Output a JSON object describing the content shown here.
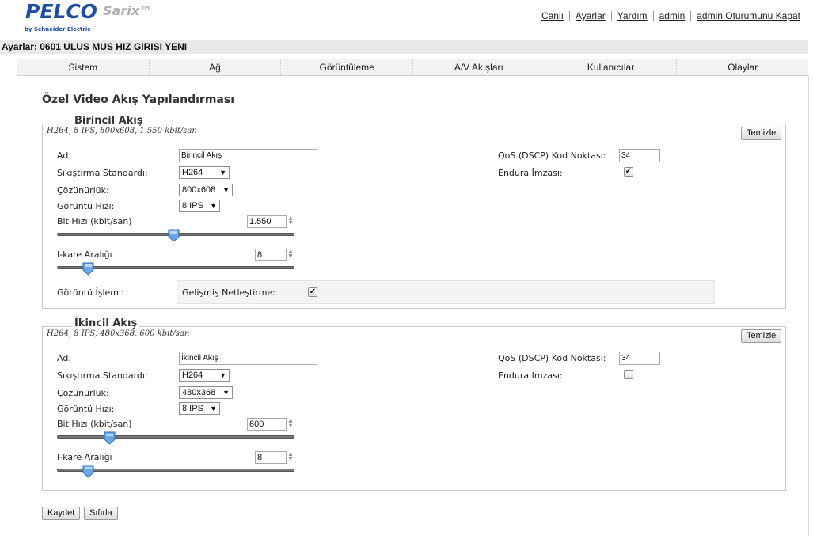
{
  "brand": {
    "logo": "PELCO",
    "product": "Sarix™",
    "sublogo": "by Schneider Electric"
  },
  "topnav": [
    "Canlı",
    "Ayarlar",
    "Yardım",
    "admin",
    "admin Oturumunu Kapat"
  ],
  "title_bar": "Ayarlar: 0601 ULUS MUS HIZ GIRISI YENI",
  "tabs": [
    "Sistem",
    "Ağ",
    "Görüntüleme",
    "A/V Akışları",
    "Kullanıcılar",
    "Olaylar"
  ],
  "page_title": "Özel Video Akış Yapılandırması",
  "primary": {
    "legend": "Birincil Akış",
    "summary": "H264, 8 IPS, 800x608, 1.550 kbit/san",
    "clear_button": "Temizle",
    "name_label": "Ad:",
    "name_value": "Birincil Akış",
    "compression_label": "Sıkıştırma Standardı:",
    "compression_value": "H264",
    "resolution_label": "Çözünürlük:",
    "resolution_value": "800x608",
    "framerate_label": "Görüntü Hızı:",
    "framerate_value": "8 IPS",
    "bitrate_label": "Bit Hızı (kbit/san)",
    "bitrate_value": "1.550",
    "bitrate_fraction": 0.49,
    "iframe_label": "I-kare Aralığı",
    "iframe_value": "8",
    "iframe_fraction": 0.13,
    "processing_label": "Görüntü İşlemi:",
    "sharpening_label": "Gelişmiş Netleştirme:",
    "sharpening_checked": true,
    "qos_label": "QoS (DSCP) Kod Noktası:",
    "qos_value": "34",
    "endura_label": "Endura İmzası:",
    "endura_checked": true
  },
  "secondary": {
    "legend": "İkincil Akış",
    "summary": "H264, 8 IPS, 480x368, 600 kbit/san",
    "clear_button": "Temizle",
    "name_label": "Ad:",
    "name_value": "İkincil Akış",
    "compression_label": "Sıkıştırma Standardı:",
    "compression_value": "H264",
    "resolution_label": "Çözünürlük:",
    "resolution_value": "480x368",
    "framerate_label": "Görüntü Hızı:",
    "framerate_value": "8 IPS",
    "bitrate_label": "Bit Hızı (kbit/san)",
    "bitrate_value": "600",
    "bitrate_fraction": 0.22,
    "iframe_label": "I-kare Aralığı",
    "iframe_value": "8",
    "iframe_fraction": 0.13,
    "qos_label": "QoS (DSCP) Kod Noktası:",
    "qos_value": "34",
    "endura_label": "Endura İmzası:",
    "endura_checked": false
  },
  "buttons": {
    "save": "Kaydet",
    "reset": "Sıfırla"
  },
  "colors": {
    "brand_blue": "#1d4ea1",
    "slider_thumb": "#4a8fd4"
  }
}
